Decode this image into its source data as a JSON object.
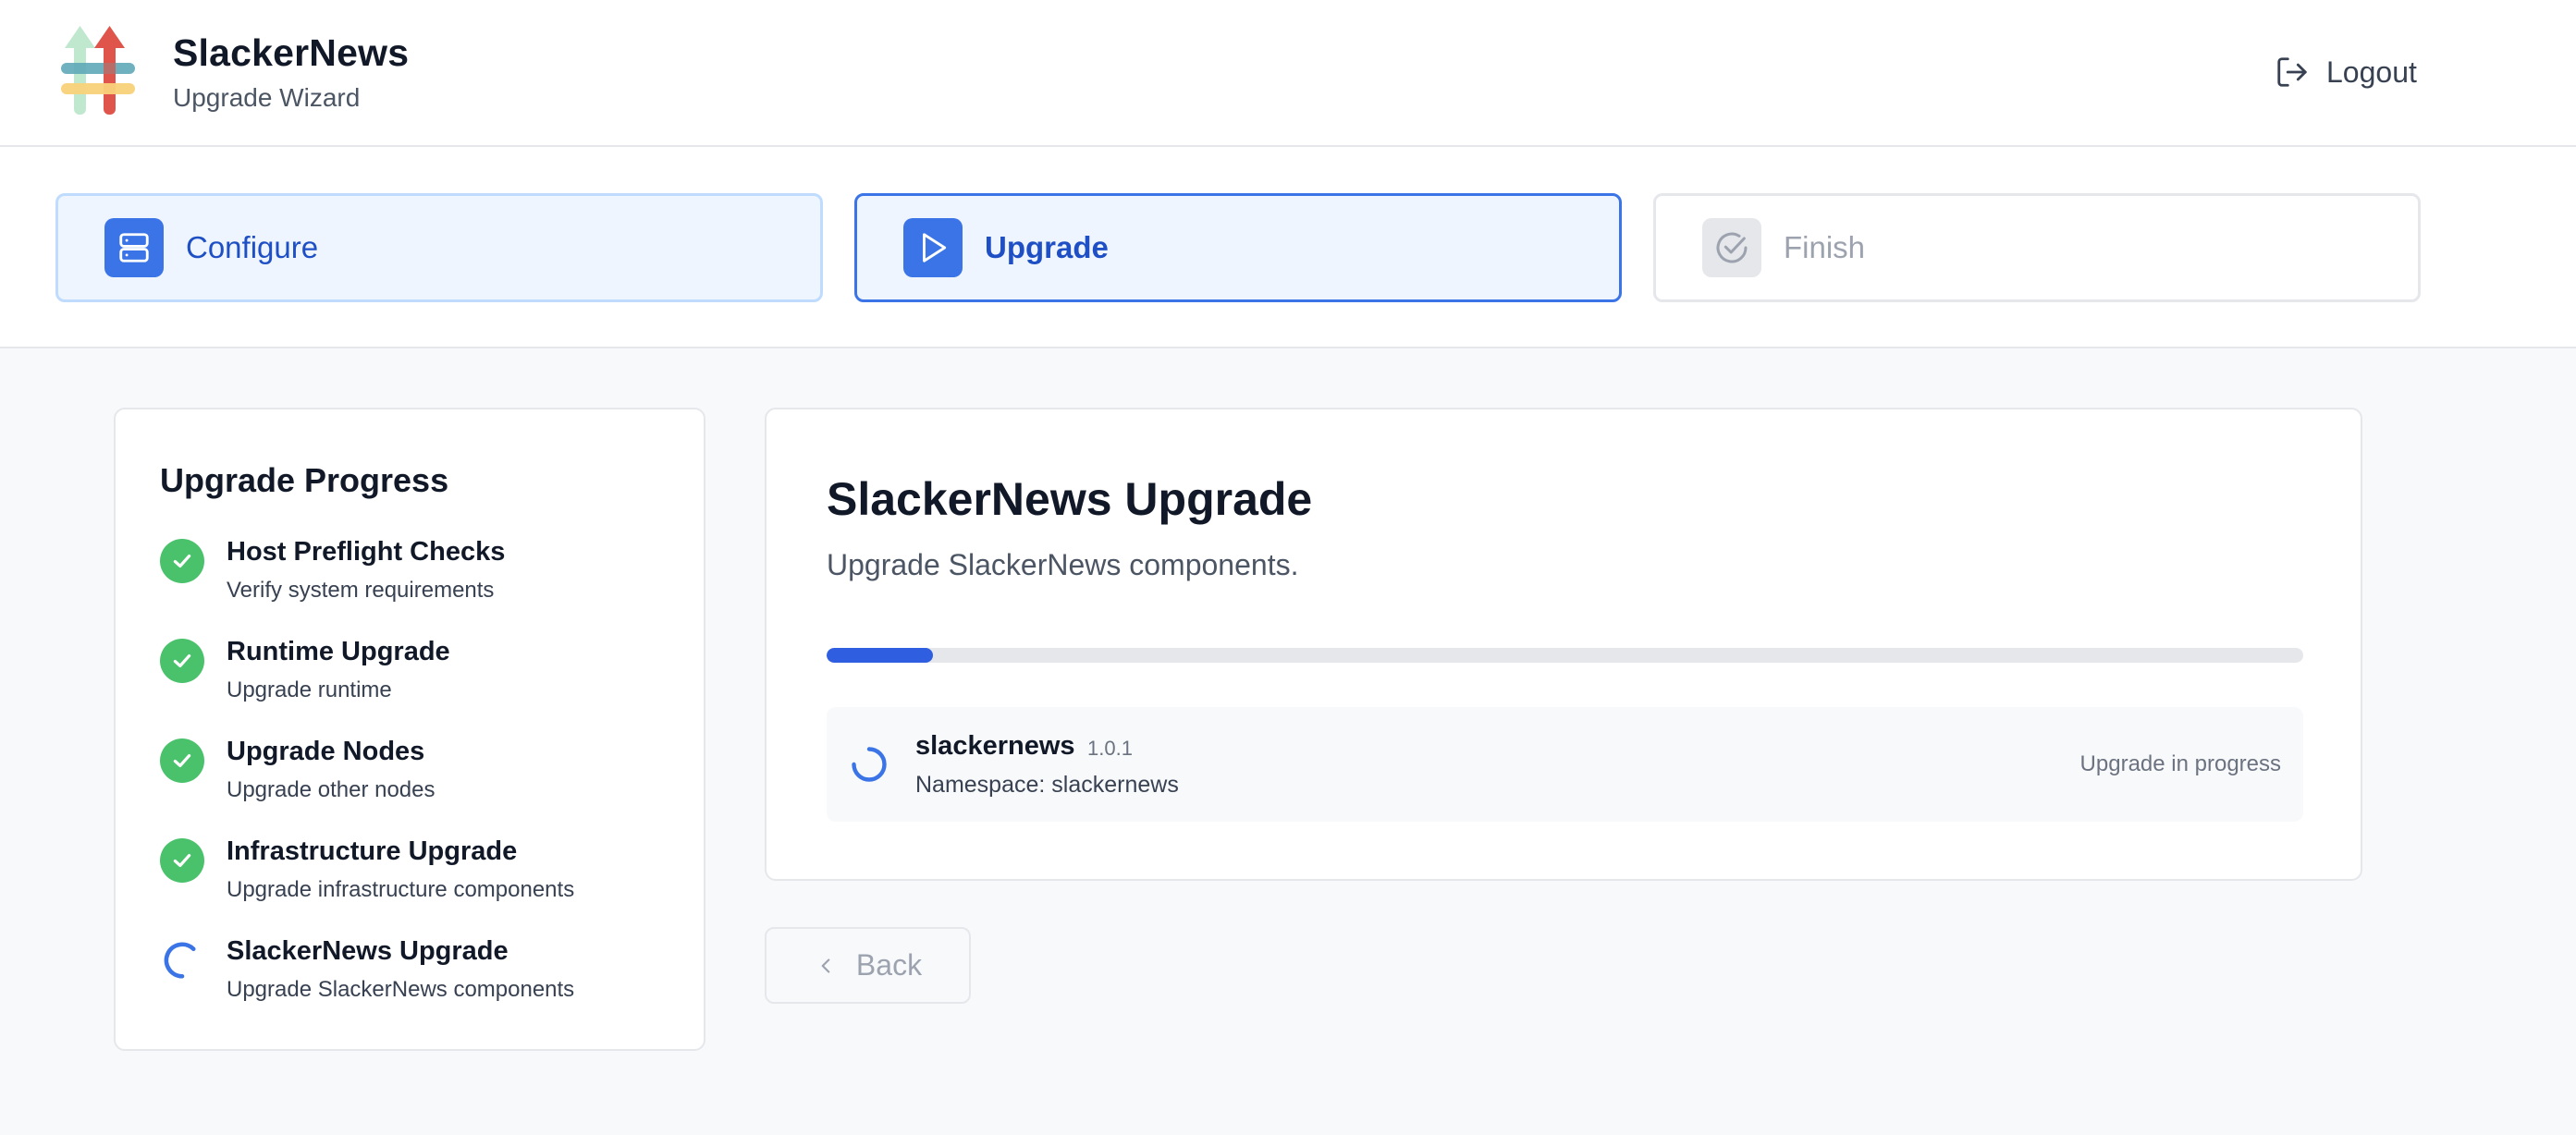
{
  "app": {
    "title": "SlackerNews",
    "subtitle": "Upgrade Wizard",
    "logout_label": "Logout"
  },
  "steps": [
    {
      "label": "Configure",
      "icon": "server-icon",
      "state": "completed"
    },
    {
      "label": "Upgrade",
      "icon": "play-icon",
      "state": "active"
    },
    {
      "label": "Finish",
      "icon": "check-circle-icon",
      "state": "pending"
    }
  ],
  "progress": {
    "title": "Upgrade Progress",
    "items": [
      {
        "title": "Host Preflight Checks",
        "description": "Verify system requirements",
        "status": "done"
      },
      {
        "title": "Runtime Upgrade",
        "description": "Upgrade runtime",
        "status": "done"
      },
      {
        "title": "Upgrade Nodes",
        "description": "Upgrade other nodes",
        "status": "done"
      },
      {
        "title": "Infrastructure Upgrade",
        "description": "Upgrade infrastructure components",
        "status": "done"
      },
      {
        "title": "SlackerNews Upgrade",
        "description": "Upgrade SlackerNews components",
        "status": "in-progress"
      }
    ]
  },
  "main": {
    "title": "SlackerNews Upgrade",
    "description": "Upgrade SlackerNews components.",
    "progress_fraction": 0.072,
    "component": {
      "name": "slackernews",
      "version": "1.0.1",
      "namespace": "Namespace: slackernews",
      "status": "Upgrade in progress"
    }
  },
  "back_label": "Back",
  "colors": {
    "accent": "#3b74e6",
    "success": "#4ac26b",
    "progress_fill": "#2f5fe0"
  }
}
